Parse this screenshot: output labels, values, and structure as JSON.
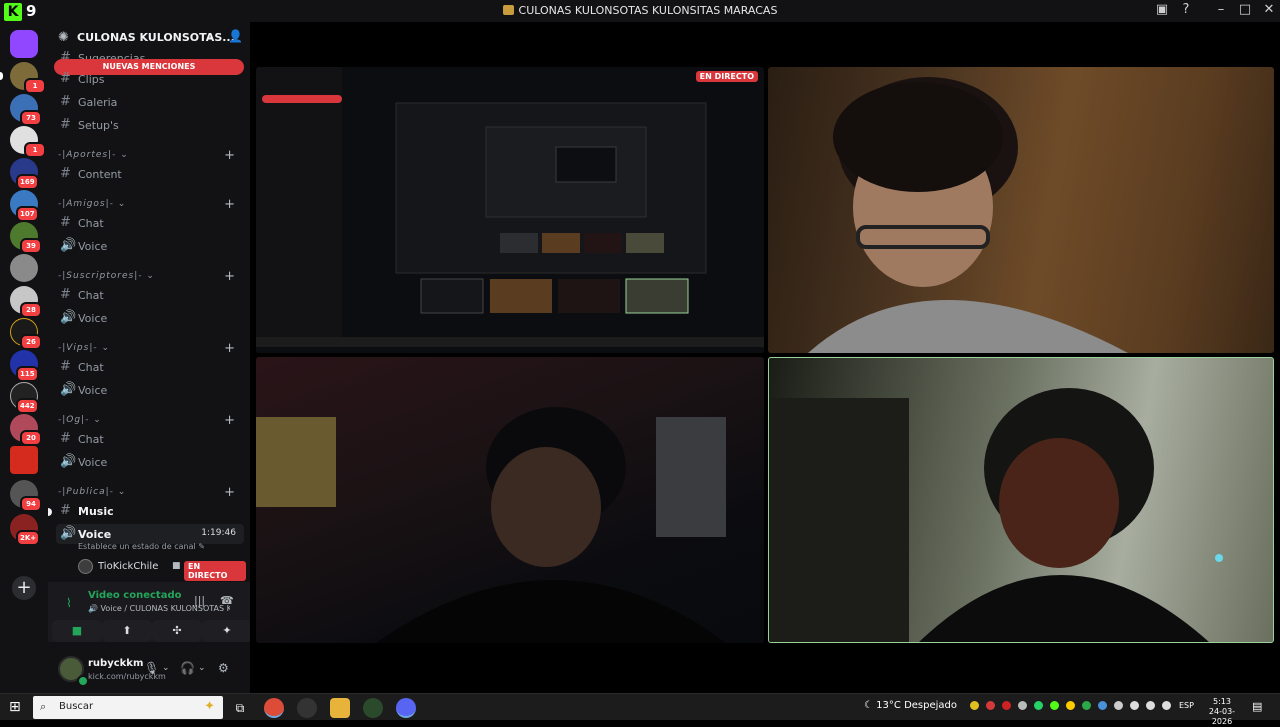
{
  "window": {
    "title": "CULONAS KULONSOTAS KULONSITAS MARACAS",
    "kick_count": "9",
    "kick_logo": "K"
  },
  "rail": {
    "badges": [
      "1",
      "73",
      "1",
      "169",
      "107",
      "39",
      "28",
      "26",
      "115",
      "442",
      "20",
      "94",
      "2K+"
    ]
  },
  "server": {
    "name": "CULONAS KULONSOTAS...",
    "mentions_banner": "NUEVAS MENCIONES",
    "channels_top": [
      {
        "icon": "hash-icon",
        "label": "Sugerencias"
      },
      {
        "icon": "hash-icon",
        "label": "Clips"
      },
      {
        "icon": "hash-icon",
        "label": "Galeria"
      },
      {
        "icon": "hash-icon",
        "label": "Setup's"
      }
    ],
    "categories": [
      {
        "name": "-|Aportes|-",
        "channels": [
          {
            "label": "Content",
            "icon": "hash-icon"
          }
        ]
      },
      {
        "name": "-|Amigos|-",
        "channels": [
          {
            "label": "Chat",
            "icon": "hash-icon"
          },
          {
            "label": "Voice",
            "icon": "speaker-icon"
          }
        ]
      },
      {
        "name": "-|Suscriptores|-",
        "channels": [
          {
            "label": "Chat",
            "icon": "hash-icon"
          },
          {
            "label": "Voice",
            "icon": "speaker-icon"
          }
        ]
      },
      {
        "name": "-|Vips|-",
        "channels": [
          {
            "label": "Chat",
            "icon": "hash-icon"
          },
          {
            "label": "Voice",
            "icon": "speaker-icon"
          }
        ]
      },
      {
        "name": "-|Og|-",
        "channels": [
          {
            "label": "Chat",
            "icon": "hash-icon"
          },
          {
            "label": "Voice",
            "icon": "speaker-icon"
          }
        ]
      },
      {
        "name": "-|Publica|-",
        "channels": [
          {
            "label": "Music",
            "icon": "hash-icon"
          },
          {
            "label": "Voice",
            "icon": "speaker-icon"
          }
        ]
      }
    ],
    "voice_timer": "1:19:46",
    "voice_status_prompt": "Establece un estado de canal",
    "voice_member": {
      "name": "TioKickChile",
      "live_label": "EN DIRECTO"
    }
  },
  "voice_panel": {
    "title": "Video conectado",
    "subtitle": "Voice / CULONAS KULONSOTAS KU..."
  },
  "user_panel": {
    "username": "rubyckkm",
    "status": "kick.com/rubyckkm"
  },
  "stage": {
    "screen_share_live_label": "EN DIRECTO"
  },
  "taskbar": {
    "search_placeholder": "Buscar",
    "weather_temp": "13°C",
    "weather_text": "Despejado",
    "language": "ESP",
    "time": "5:13",
    "date": "24-03-2026"
  }
}
